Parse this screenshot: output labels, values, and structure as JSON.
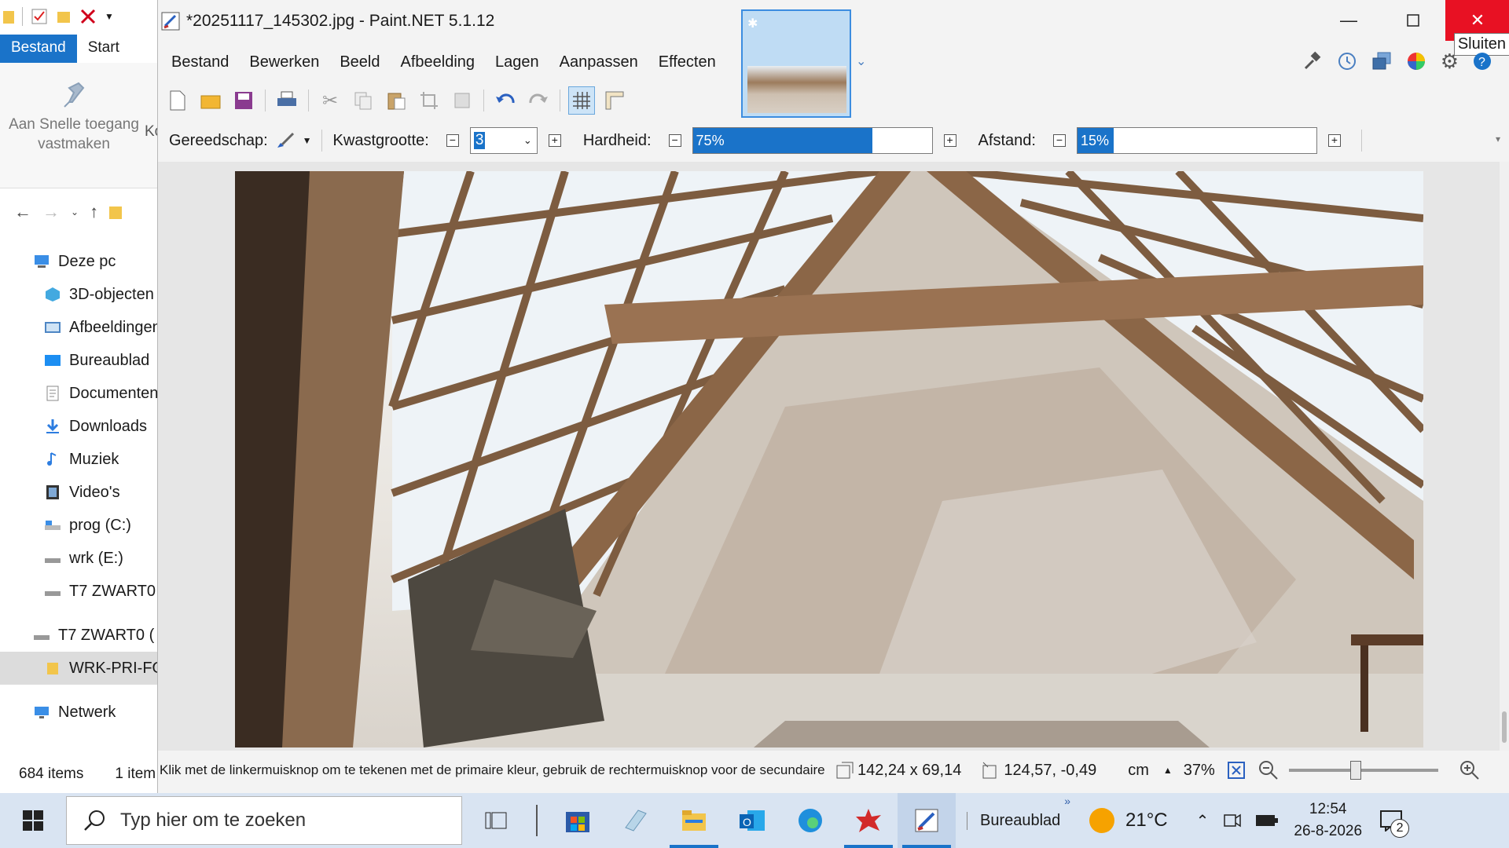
{
  "explorer": {
    "ribbon_tabs": [
      "Bestand",
      "Start"
    ],
    "pin_label": "Aan Snelle toegang vastmaken",
    "pin_clip": "Ko",
    "tree": [
      {
        "label": "Deze pc",
        "icon": "computer-icon",
        "level": 1
      },
      {
        "label": "3D-objecten",
        "icon": "3d-objects-icon",
        "level": 2
      },
      {
        "label": "Afbeeldingen",
        "icon": "pictures-icon",
        "level": 2
      },
      {
        "label": "Bureaublad",
        "icon": "desktop-icon",
        "level": 2
      },
      {
        "label": "Documenten",
        "icon": "documents-icon",
        "level": 2
      },
      {
        "label": "Downloads",
        "icon": "downloads-icon",
        "level": 2
      },
      {
        "label": "Muziek",
        "icon": "music-icon",
        "level": 2
      },
      {
        "label": "Video's",
        "icon": "videos-icon",
        "level": 2
      },
      {
        "label": "prog (C:)",
        "icon": "drive-icon",
        "level": 2
      },
      {
        "label": "wrk (E:)",
        "icon": "drive-icon",
        "level": 2
      },
      {
        "label": "T7 ZWART0",
        "icon": "drive-icon",
        "level": 2
      },
      {
        "label": "T7 ZWART0 (",
        "icon": "drive-icon",
        "level": 1
      },
      {
        "label": "WRK-PRI-FO",
        "icon": "folder-icon",
        "level": 2,
        "selected": true
      },
      {
        "label": "Netwerk",
        "icon": "network-icon",
        "level": 1
      }
    ],
    "status_items": "684 items",
    "status_selected": "1 item"
  },
  "paint": {
    "title": "*20251117_145302.jpg - Paint.NET 5.1.12",
    "tooltip": "Sluiten",
    "menu": [
      "Bestand",
      "Bewerken",
      "Beeld",
      "Afbeelding",
      "Lagen",
      "Aanpassen",
      "Effecten"
    ],
    "options": {
      "tool_label": "Gereedschap:",
      "brush_size_label": "Kwastgrootte:",
      "brush_size_value": "3",
      "hardness_label": "Hardheid:",
      "hardness_value": "75%",
      "hardness_fraction": 0.75,
      "spacing_label": "Afstand:",
      "spacing_value": "15%",
      "spacing_fraction": 0.15
    },
    "status": {
      "hint": "Klik met de linkermuisknop om te tekenen met de primaire kleur, gebruik de rechtermuisknop voor de secundaire kleur.",
      "image_size": "142,24 x 69,14",
      "cursor_pos": "124,57, -0,49",
      "unit": "cm",
      "zoom": "37%"
    }
  },
  "taskbar": {
    "search_placeholder": "Typ hier om te zoeken",
    "desktop_label": "Bureaublad",
    "temperature": "21°C",
    "time": "12:54",
    "date": "26-8-2026",
    "notification_count": "2"
  },
  "colors": {
    "accent": "#1a73c9",
    "close_red": "#e81123"
  }
}
